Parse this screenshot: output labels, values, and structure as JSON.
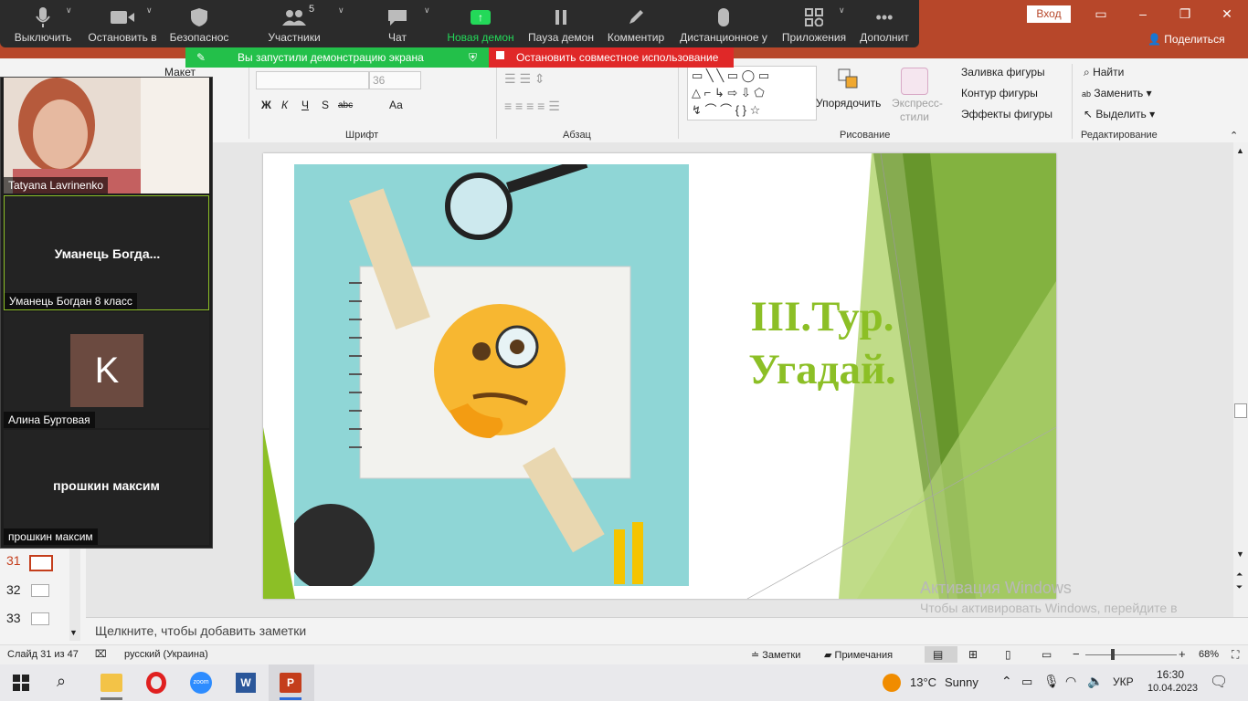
{
  "ppt": {
    "login": "Вход",
    "share": "Поделиться"
  },
  "zoom": {
    "buttons": [
      {
        "label": "Выключить",
        "icon": "microphone-icon"
      },
      {
        "label": "Остановить в",
        "icon": "video-camera-icon"
      },
      {
        "label": "Безопаснос",
        "icon": "shield-icon"
      },
      {
        "label": "Участники",
        "icon": "participants-icon",
        "count": "5"
      },
      {
        "label": "Чат",
        "icon": "chat-icon"
      },
      {
        "label": "Новая демон",
        "icon": "share-screen-icon"
      },
      {
        "label": "Пауза демон",
        "icon": "pause-icon"
      },
      {
        "label": "Комментир",
        "icon": "annotate-pen-icon"
      },
      {
        "label": "Дистанционное у",
        "icon": "remote-control-mouse-icon"
      },
      {
        "label": "Приложения",
        "icon": "apps-icon"
      },
      {
        "label": "Дополнит",
        "icon": "more-icon"
      }
    ],
    "share_notice": "Вы запустили демонстрацию экрана",
    "stop_share": "Остановить совместное использование",
    "accent_green": "#23d959",
    "stop_red": "#e02828"
  },
  "ribbon": {
    "layout_btn": "Макет",
    "font_size": "36",
    "font_group": "Шрифт",
    "paragraph_group": "Абзац",
    "drawing_group": "Рисование",
    "editing_group": "Редактирование",
    "arrange": "Упорядочить",
    "express_styles": "Экспресс-стили",
    "shape_fill": "Заливка фигуры",
    "shape_outline": "Контур фигуры",
    "shape_effects": "Эффекты фигуры",
    "find": "Найти",
    "replace": "Заменить",
    "select": "Выделить",
    "bold": "Ж",
    "italic": "К",
    "underline": "Ч",
    "strike": "S",
    "spacing": "abc",
    "case": "Аа"
  },
  "gallery": {
    "tiles": [
      {
        "name": "Tatyana Lavrinenko"
      },
      {
        "big": "Уманець  Богда...",
        "name": "Уманець Богдан 8 класс"
      },
      {
        "initial": "K",
        "name": "Алина Буртовая"
      },
      {
        "big": "прошкин максим",
        "name": "прошкин максим"
      }
    ]
  },
  "slides_panel": {
    "items": [
      {
        "num": "31"
      },
      {
        "num": "32"
      },
      {
        "num": "33"
      }
    ]
  },
  "slide": {
    "title_line1": "III.Тур.",
    "title_line2": "Угадай.",
    "title_color": "#8cbf26"
  },
  "notes": {
    "placeholder": "Щелкните, чтобы добавить заметки"
  },
  "watermark": {
    "title": "Активация Windows",
    "body": "Чтобы активировать Windows, перейдите в раздел \"Параметры\"."
  },
  "status": {
    "slide_info": "Слайд 31 из 47",
    "language": "русский (Украина)",
    "notes_btn": "Заметки",
    "comments_btn": "Примечания",
    "zoom_level": "68%",
    "zoom_minus": "−",
    "zoom_plus": "+"
  },
  "taskbar": {
    "weather_temp": "13°C",
    "weather_desc": "Sunny",
    "lang": "УКР",
    "time": "16:30",
    "date": "10.04.2023"
  }
}
